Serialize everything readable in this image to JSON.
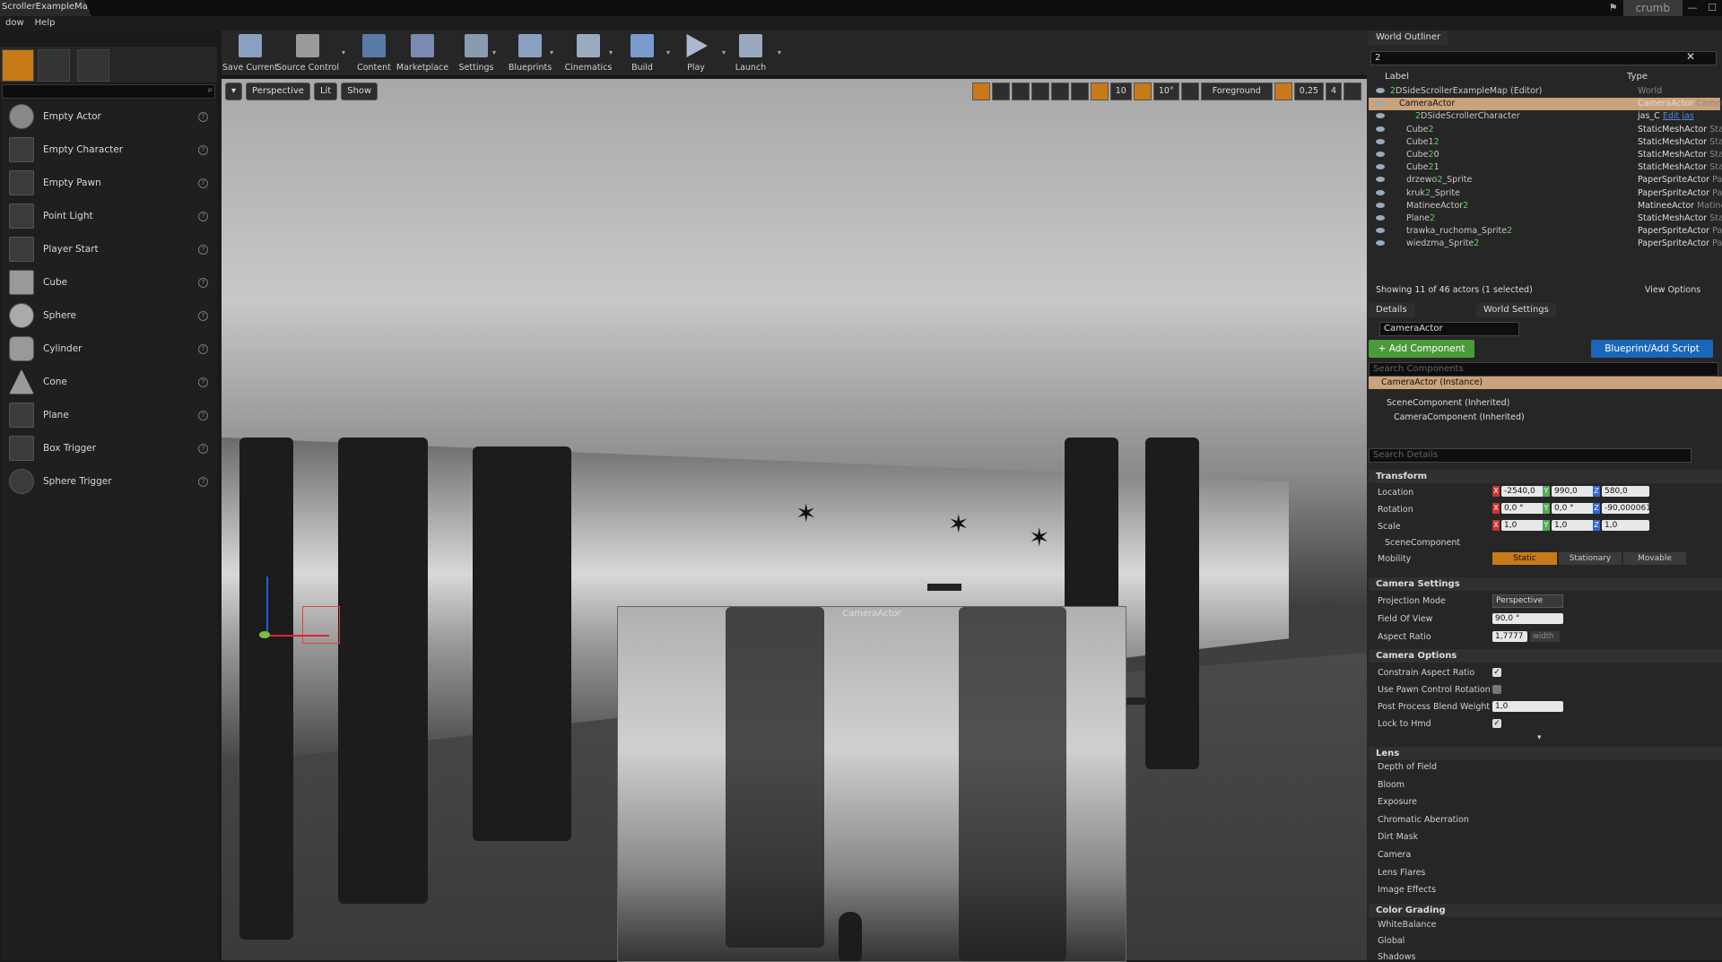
{
  "titlebar": {
    "tab": "ScrollerExampleMap*",
    "crumb": "crumb"
  },
  "menu": [
    "dow",
    "Help"
  ],
  "placement": {
    "items": [
      "Empty Actor",
      "Empty Character",
      "Empty Pawn",
      "Point Light",
      "Player Start",
      "Cube",
      "Sphere",
      "Cylinder",
      "Cone",
      "Plane",
      "Box Trigger",
      "Sphere Trigger"
    ],
    "help": "?"
  },
  "toolbar": {
    "save_current": "Save Current",
    "source_control": "Source Control",
    "content": "Content",
    "marketplace": "Marketplace",
    "settings": "Settings",
    "blueprints": "Blueprints",
    "cinematics": "Cinematics",
    "build": "Build",
    "play": "Play",
    "launch": "Launch"
  },
  "viewport": {
    "perspective": "Perspective",
    "lit": "Lit",
    "show": "Show",
    "grid_snap": "10",
    "rot_snap": "10°",
    "foreground": "Foreground",
    "scale_snap": "0,25",
    "cam_speed": "4",
    "camera_preview_label": "CameraActor"
  },
  "outliner": {
    "tab": "World Outliner",
    "search": "2",
    "col_label": "Label",
    "col_type": "Type",
    "rows": [
      {
        "label_pre": "",
        "label_num": "2",
        "label_post": "DSideScrollerExampleMap (Editor)",
        "type_cls": "",
        "type": "World",
        "selected": false,
        "indent": 24
      },
      {
        "label_pre": "CameraActor",
        "label_num": "",
        "label_post": "",
        "type_cls": "CameraActor",
        "type": "CameraActor",
        "selected": true,
        "indent": 34
      },
      {
        "label_pre": "",
        "label_num": "2",
        "label_post": "DSideScrollerCharacter",
        "type_cls": "jas_C",
        "type": "Edit jas",
        "selected": false,
        "indent": 52
      },
      {
        "label_pre": "Cube",
        "label_num": "2",
        "label_post": "",
        "type_cls": "StaticMeshActor",
        "type": "StaticMeshActor",
        "selected": false,
        "indent": 42
      },
      {
        "label_pre": "Cube1",
        "label_num": "2",
        "label_post": "",
        "type_cls": "StaticMeshActor",
        "type": "StaticMeshActor",
        "selected": false,
        "indent": 42
      },
      {
        "label_pre": "Cube",
        "label_num": "2",
        "label_post": "0",
        "type_cls": "StaticMeshActor",
        "type": "StaticMeshActor",
        "selected": false,
        "indent": 42
      },
      {
        "label_pre": "Cube",
        "label_num": "2",
        "label_post": "1",
        "type_cls": "StaticMeshActor",
        "type": "StaticMeshActor",
        "selected": false,
        "indent": 42
      },
      {
        "label_pre": "drzewo",
        "label_num": "2",
        "label_post": "_Sprite",
        "type_cls": "PaperSpriteActor",
        "type": "PaperSpriteActor",
        "selected": false,
        "indent": 42
      },
      {
        "label_pre": "kruk",
        "label_num": "2",
        "label_post": "_Sprite",
        "type_cls": "PaperSpriteActor",
        "type": "PaperSpriteActor",
        "selected": false,
        "indent": 42
      },
      {
        "label_pre": "MatineeActor",
        "label_num": "2",
        "label_post": "",
        "type_cls": "MatineeActor",
        "type": "MatineeActor",
        "selected": false,
        "indent": 42
      },
      {
        "label_pre": "Plane",
        "label_num": "2",
        "label_post": "",
        "type_cls": "StaticMeshActor",
        "type": "StaticMeshActor",
        "selected": false,
        "indent": 42
      },
      {
        "label_pre": "trawka_ruchoma_Sprite",
        "label_num": "2",
        "label_post": "",
        "type_cls": "PaperSpriteActor",
        "type": "PaperSpriteActor",
        "selected": false,
        "indent": 42
      },
      {
        "label_pre": "wiedzma_Sprite",
        "label_num": "2",
        "label_post": "",
        "type_cls": "PaperSpriteActor",
        "type": "PaperSpriteActor",
        "selected": false,
        "indent": 42
      }
    ],
    "status": "Showing 11 of 46 actors (1 selected)",
    "view_options": "View Options"
  },
  "details": {
    "tab_details": "Details",
    "tab_world": "World Settings",
    "actor_name": "CameraActor",
    "add_component": "+ Add Component",
    "blueprint": "Blueprint/Add Script",
    "search_components": "Search Components",
    "instance": "CameraActor (Instance)",
    "scene_comp": "SceneComponent (Inherited)",
    "camera_comp": "CameraComponent (Inherited)",
    "search_details": "Search Details",
    "transform": {
      "header": "Transform",
      "location": "Location",
      "rotation": "Rotation",
      "scale": "Scale",
      "loc": [
        "-2540,0",
        "990,0",
        "580,0"
      ],
      "rot": [
        "0,0 °",
        "0,0 °",
        "-90,000061 °"
      ],
      "scl": [
        "1,0",
        "1,0",
        "1,0"
      ],
      "scene_component": "SceneComponent",
      "mobility": "Mobility",
      "static": "Static",
      "stationary": "Stationary",
      "movable": "Movable"
    },
    "camera_settings": {
      "header": "Camera Settings",
      "projection_mode": "Projection Mode",
      "projection_value": "Perspective",
      "fov": "Field Of View",
      "fov_value": "90,0 °",
      "aspect": "Aspect Ratio",
      "aspect_value": "1,7777",
      "aspect_unit": "width"
    },
    "camera_options": {
      "header": "Camera Options",
      "constrain": "Constrain Aspect Ratio",
      "pawn_rot": "Use Pawn Control Rotation",
      "blend": "Post Process Blend Weight",
      "blend_value": "1,0",
      "hmd": "Lock to Hmd"
    },
    "lens": {
      "header": "Lens",
      "items": [
        "Depth of Field",
        "Bloom",
        "Exposure",
        "Chromatic Aberration",
        "Dirt Mask",
        "Camera",
        "Lens Flares",
        "Image Effects"
      ]
    },
    "color_grading": {
      "header": "Color Grading",
      "items": [
        "WhiteBalance",
        "Global",
        "Shadows"
      ]
    }
  },
  "colors": {
    "accent_orange": "#c87a18",
    "selection": "#caa27c",
    "add_component": "#4a9a3a",
    "blueprint": "#1a66b8"
  }
}
